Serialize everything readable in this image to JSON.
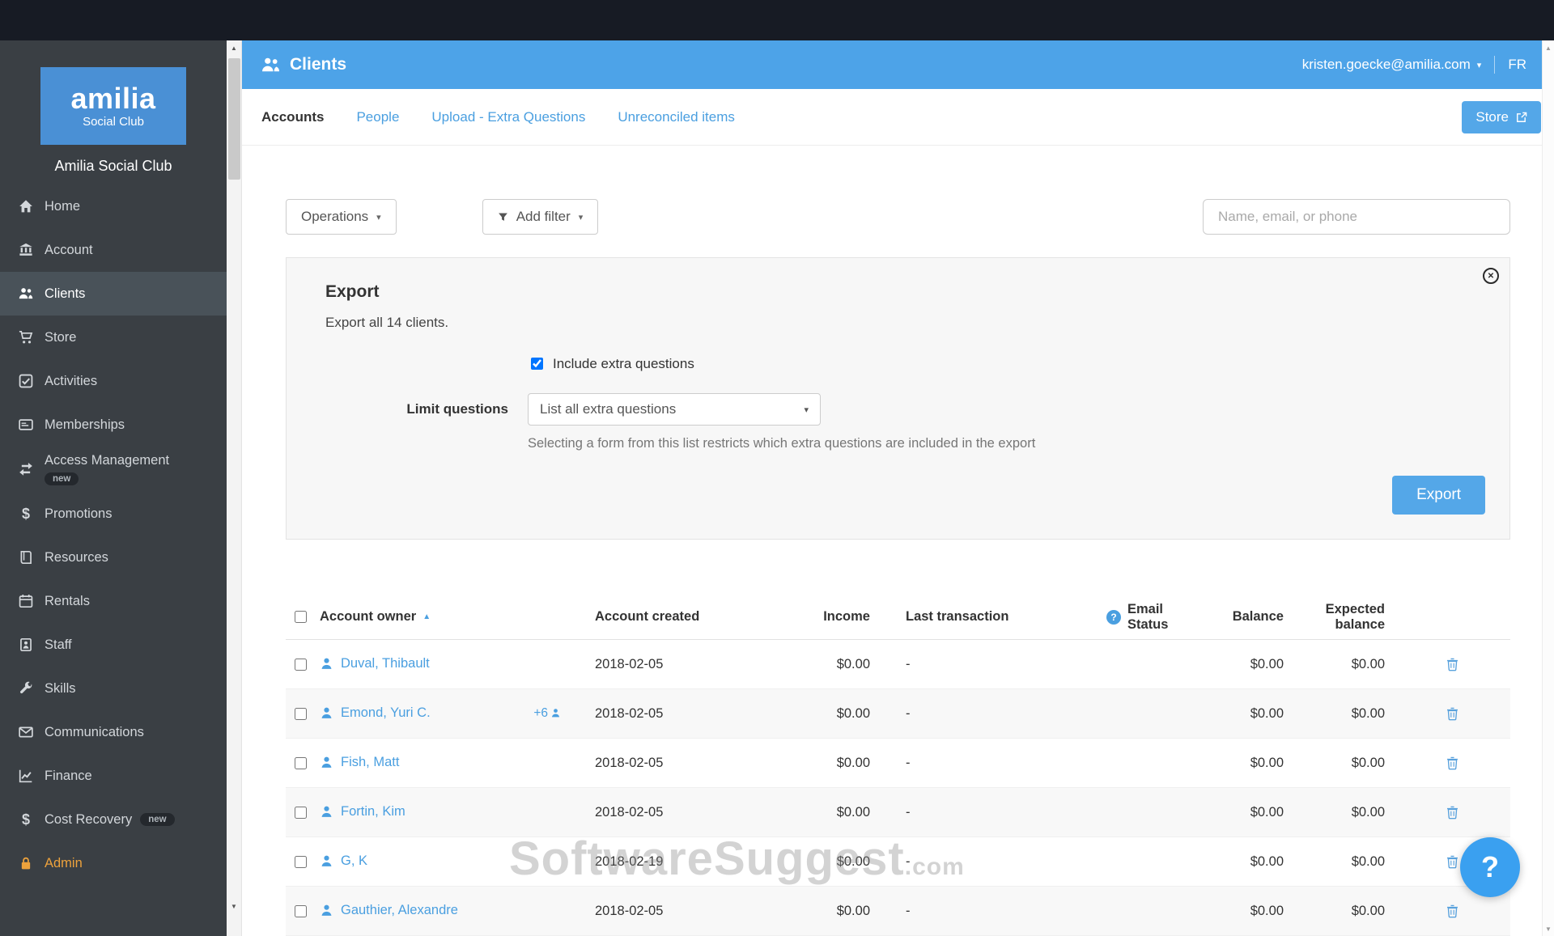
{
  "brand": {
    "logo_word": "amilia",
    "logo_sub": "Social Club",
    "org_name": "Amilia Social Club"
  },
  "sidebar": {
    "items": [
      {
        "label": "Home",
        "icon": "home-icon"
      },
      {
        "label": "Account",
        "icon": "bank-icon"
      },
      {
        "label": "Clients",
        "icon": "people-icon",
        "active": true
      },
      {
        "label": "Store",
        "icon": "cart-icon"
      },
      {
        "label": "Activities",
        "icon": "check-square-icon"
      },
      {
        "label": "Memberships",
        "icon": "card-icon"
      },
      {
        "label": "Access Management",
        "icon": "exchange-icon",
        "badge": "new",
        "badge_below": true
      },
      {
        "label": "Promotions",
        "icon": "dollar-icon"
      },
      {
        "label": "Resources",
        "icon": "book-icon"
      },
      {
        "label": "Rentals",
        "icon": "calendar-icon"
      },
      {
        "label": "Staff",
        "icon": "id-badge-icon"
      },
      {
        "label": "Skills",
        "icon": "tools-icon"
      },
      {
        "label": "Communications",
        "icon": "envelope-icon"
      },
      {
        "label": "Finance",
        "icon": "chart-icon"
      },
      {
        "label": "Cost Recovery",
        "icon": "dollar-icon",
        "badge": "new"
      },
      {
        "label": "Admin",
        "icon": "lock-icon",
        "accent": true
      }
    ]
  },
  "header": {
    "title": "Clients",
    "user_email": "kristen.goecke@amilia.com",
    "language": "FR"
  },
  "tabs": [
    {
      "label": "Accounts",
      "active": true
    },
    {
      "label": "People",
      "active": false
    },
    {
      "label": "Upload - Extra Questions",
      "active": false
    },
    {
      "label": "Unreconciled items",
      "active": false
    }
  ],
  "store_button": {
    "label": "Store"
  },
  "toolbar": {
    "operations": "Operations",
    "add_filter": "Add filter",
    "search_placeholder": "Name, email, or phone"
  },
  "export_panel": {
    "title": "Export",
    "description": "Export all 14 clients.",
    "include_extra_questions": "Include extra questions",
    "include_checked": true,
    "limit_questions_label": "Limit questions",
    "limit_questions_value": "List all extra questions",
    "helper_text": "Selecting a form from this list restricts which extra questions are included in the export",
    "export_button": "Export"
  },
  "table": {
    "sort": "asc",
    "columns": {
      "owner": "Account owner",
      "created": "Account created",
      "income": "Income",
      "last_transaction": "Last transaction",
      "email_status_line1": "Email",
      "email_status_line2": "Status",
      "balance": "Balance",
      "expected_line1": "Expected",
      "expected_line2": "balance"
    },
    "rows": [
      {
        "owner": "Duval, Thibault",
        "extra_members": "",
        "created": "2018-02-05",
        "income": "$0.00",
        "last_transaction": "-",
        "email_status": "",
        "balance": "$0.00",
        "expected_balance": "$0.00"
      },
      {
        "owner": "Emond, Yuri C.",
        "extra_members": "+6",
        "created": "2018-02-05",
        "income": "$0.00",
        "last_transaction": "-",
        "email_status": "",
        "balance": "$0.00",
        "expected_balance": "$0.00"
      },
      {
        "owner": "Fish, Matt",
        "extra_members": "",
        "created": "2018-02-05",
        "income": "$0.00",
        "last_transaction": "-",
        "email_status": "",
        "balance": "$0.00",
        "expected_balance": "$0.00"
      },
      {
        "owner": "Fortin, Kim",
        "extra_members": "",
        "created": "2018-02-05",
        "income": "$0.00",
        "last_transaction": "-",
        "email_status": "",
        "balance": "$0.00",
        "expected_balance": "$0.00"
      },
      {
        "owner": "G, K",
        "extra_members": "",
        "created": "2018-02-19",
        "income": "$0.00",
        "last_transaction": "-",
        "email_status": "",
        "balance": "$0.00",
        "expected_balance": "$0.00"
      },
      {
        "owner": "Gauthier, Alexandre",
        "extra_members": "",
        "created": "2018-02-05",
        "income": "$0.00",
        "last_transaction": "-",
        "email_status": "",
        "balance": "$0.00",
        "expected_balance": "$0.00"
      }
    ]
  },
  "watermark": {
    "main": "SoftwareSuggest",
    "suffix": ".com"
  },
  "help_button": "?",
  "colors": {
    "header_blue": "#4da3e8",
    "link_blue": "#4a9fe0",
    "button_blue": "#54a7e8",
    "sidebar_bg": "#3a3f44",
    "sidebar_active": "#495259",
    "topbar_bg": "#171b24",
    "admin_accent": "#eda23c"
  }
}
